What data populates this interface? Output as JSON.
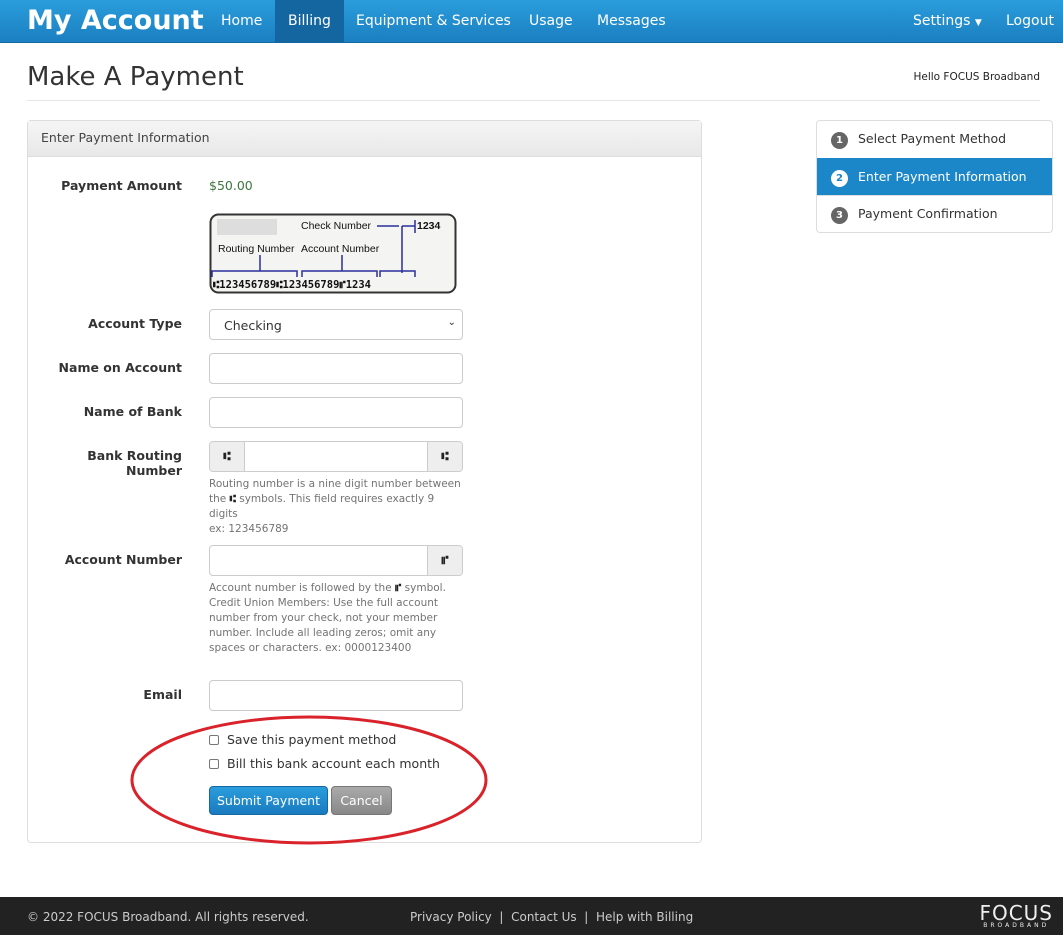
{
  "nav": {
    "brand": "My Account",
    "items": [
      "Home",
      "Billing",
      "Equipment & Services",
      "Usage",
      "Messages"
    ],
    "active": "Billing",
    "settings": "Settings",
    "logout": "Logout"
  },
  "page": {
    "title": "Make A Payment",
    "greeting": "Hello FOCUS Broadband"
  },
  "panel": {
    "heading": "Enter Payment Information"
  },
  "form": {
    "amount_label": "Payment Amount",
    "amount_value": "$50.00",
    "check_image": {
      "check_number_label": "Check Number",
      "routing_label": "Routing Number",
      "account_label": "Account Number",
      "micr": "⑆123456789⑆123456789⑈1234",
      "check_number": "1234"
    },
    "account_type_label": "Account Type",
    "account_type_value": "Checking",
    "name_label": "Name on Account",
    "name_value": "",
    "bank_label": "Name of Bank",
    "bank_value": "",
    "routing_label": "Bank Routing Number",
    "routing_value": "",
    "routing_symbol": "⑆",
    "routing_help": [
      "Routing number is a nine digit number between",
      "symbols. This field requires exactly 9 digits",
      "ex: 123456789"
    ],
    "routing_help_the": "the",
    "account_label": "Account Number",
    "account_value": "",
    "account_symbol": "⑈",
    "account_help_a": "Account number is followed by the",
    "account_help_b": "symbol.",
    "account_help_rest": "Credit Union Members: Use the full account number from your check, not your member number. Include all leading zeros; omit any spaces or characters. ex: 0000123400",
    "email_label": "Email",
    "email_value": "",
    "save_label": "Save this payment method",
    "autopay_label": "Bill this bank account each month",
    "submit": "Submit Payment",
    "cancel": "Cancel"
  },
  "steps": [
    {
      "n": "1",
      "label": "Select Payment Method"
    },
    {
      "n": "2",
      "label": "Enter Payment Information",
      "active": true
    },
    {
      "n": "3",
      "label": "Payment Confirmation"
    }
  ],
  "footer": {
    "copyright": "© 2022 FOCUS Broadband. All rights reserved.",
    "links": [
      "Privacy Policy",
      "Contact Us",
      "Help with Billing"
    ],
    "logo": "FOCUS BROADBAND"
  },
  "colors": {
    "nav": "#1b87c9",
    "highlight_circle": "#d9222a",
    "amount": "#3c763d"
  }
}
